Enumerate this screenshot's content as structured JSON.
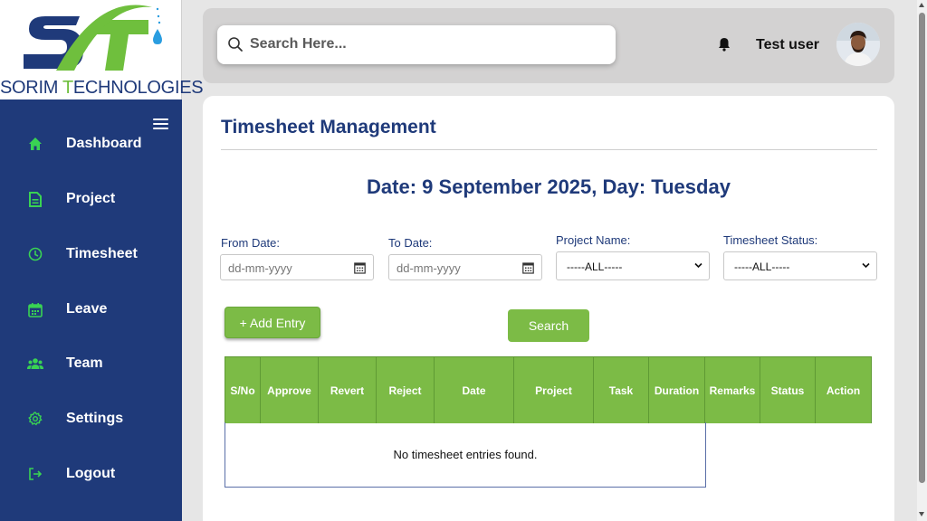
{
  "brand": {
    "name_part1": "SORIM ",
    "name_t": "T",
    "name_part2": "ECHNOLOGIES",
    "logo_colors": {
      "navy": "#1f3a7a",
      "green": "#6fbf3d",
      "drop": "#2a9de0"
    }
  },
  "sidebar": {
    "background": "#1f3a7a",
    "icon_color": "#39d353",
    "items": [
      {
        "label": "Dashboard",
        "icon": "home-icon"
      },
      {
        "label": "Project",
        "icon": "document-icon"
      },
      {
        "label": "Timesheet",
        "icon": "clock-icon"
      },
      {
        "label": "Leave",
        "icon": "calendar-icon"
      },
      {
        "label": "Team",
        "icon": "users-icon"
      },
      {
        "label": "Settings",
        "icon": "gear-icon"
      },
      {
        "label": "Logout",
        "icon": "logout-icon"
      }
    ]
  },
  "header": {
    "search_placeholder": "Search Here...",
    "user_name": "Test user"
  },
  "main": {
    "title": "Timesheet Management",
    "date_heading": "Date: 9 September 2025, Day: Tuesday",
    "filters": {
      "from_date_label": "From Date:",
      "from_date_placeholder": "dd-mm-yyyy",
      "to_date_label": "To Date:",
      "to_date_placeholder": "dd-mm-yyyy",
      "project_label": "Project Name:",
      "project_value": "-----ALL-----",
      "status_label": "Timesheet Status:",
      "status_value": "-----ALL-----"
    },
    "add_entry_label": "+ Add Entry",
    "search_label": "Search",
    "table": {
      "columns": [
        "S/No",
        "Approve",
        "Revert",
        "Reject",
        "Date",
        "Project",
        "Task",
        "Duration",
        "Remarks",
        "Status",
        "Action"
      ],
      "empty_message": "No timesheet entries found."
    },
    "accent_green": "#7cbb46"
  }
}
